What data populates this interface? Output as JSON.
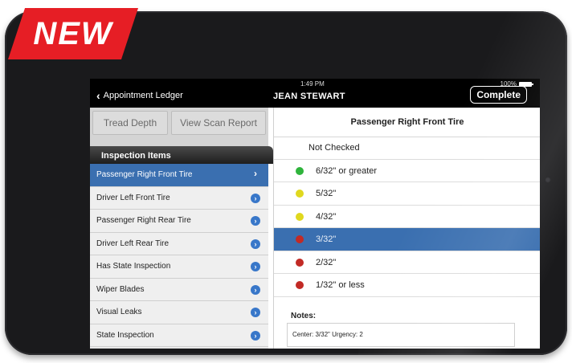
{
  "badge": {
    "label": "NEW"
  },
  "status": {
    "time": "1:49 PM",
    "battery": "100%"
  },
  "navbar": {
    "back_label": "Appointment Ledger",
    "title": "JEAN STEWART",
    "complete_label": "Complete"
  },
  "left": {
    "tabs": [
      {
        "label": "Tread Depth"
      },
      {
        "label": "View Scan Report"
      }
    ],
    "section_title": "Inspection Items",
    "items": [
      {
        "label": "Passenger Right Front Tire"
      },
      {
        "label": "Driver Left Front Tire"
      },
      {
        "label": "Passenger Right Rear Tire"
      },
      {
        "label": "Driver Left Rear Tire"
      },
      {
        "label": "Has State Inspection"
      },
      {
        "label": "Wiper Blades"
      },
      {
        "label": "Visual Leaks"
      },
      {
        "label": "State Inspection"
      }
    ],
    "active_index": 0
  },
  "right": {
    "title": "Passenger Right Front Tire",
    "options": [
      {
        "label": "Not Checked",
        "color": ""
      },
      {
        "label": "6/32\" or greater",
        "color": "#2fb43c"
      },
      {
        "label": "5/32\"",
        "color": "#e0d81e"
      },
      {
        "label": "4/32\"",
        "color": "#e0d81e"
      },
      {
        "label": "3/32\"",
        "color": "#c22a25"
      },
      {
        "label": "2/32\"",
        "color": "#c22a25"
      },
      {
        "label": "1/32\" or less",
        "color": "#c22a25"
      }
    ],
    "selected_index": 4,
    "notes_label": "Notes:",
    "notes_value": "Center: 3/32\" Urgency: 2"
  },
  "colors": {
    "accent": "#3a6fb0",
    "badge": "#e61e25"
  },
  "icons": {
    "back": "chevron-left-icon",
    "item": "chevron-right-circle-icon",
    "battery": "battery-icon"
  }
}
